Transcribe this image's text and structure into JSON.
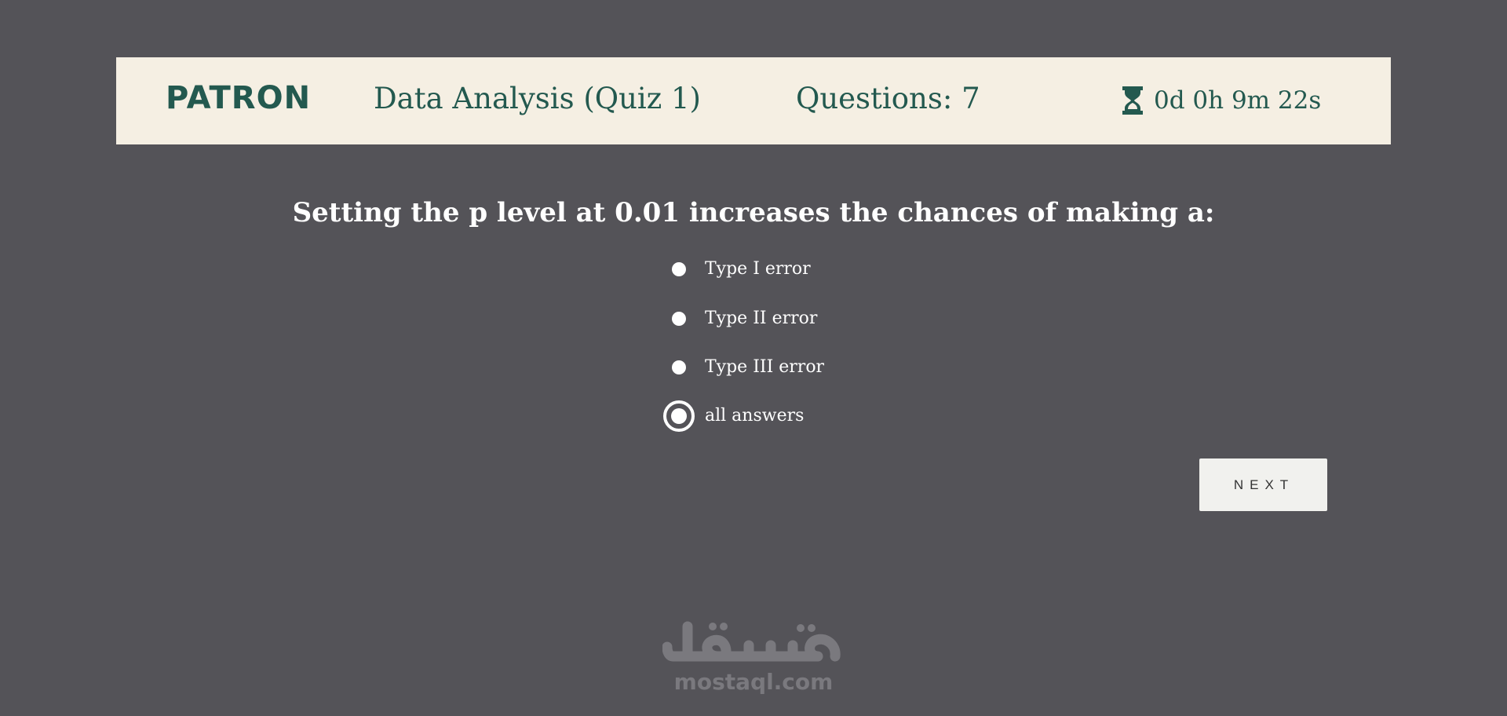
{
  "header": {
    "brand": "PATRON",
    "quiz_title": "Data Analysis (Quiz 1)",
    "question_count": "Questions: 7",
    "timer": {
      "icon": "hourglass-icon",
      "text": "0d 0h 9m 22s"
    }
  },
  "question": {
    "text": "Setting the p level at 0.01 increases the chances of making a:",
    "options": [
      {
        "label": "Type I error",
        "selected": false
      },
      {
        "label": "Type II error",
        "selected": false
      },
      {
        "label": "Type III error",
        "selected": false
      },
      {
        "label": "all answers",
        "selected": true
      }
    ]
  },
  "actions": {
    "next_label": "NEXT"
  },
  "watermark": {
    "arabic": "مستقل",
    "url": "mostaql.com"
  },
  "colors": {
    "background": "#545358",
    "header_bg": "#f5efe3",
    "accent": "#23594f",
    "text_light": "#ffffff",
    "button_bg": "#f1f1ee"
  }
}
